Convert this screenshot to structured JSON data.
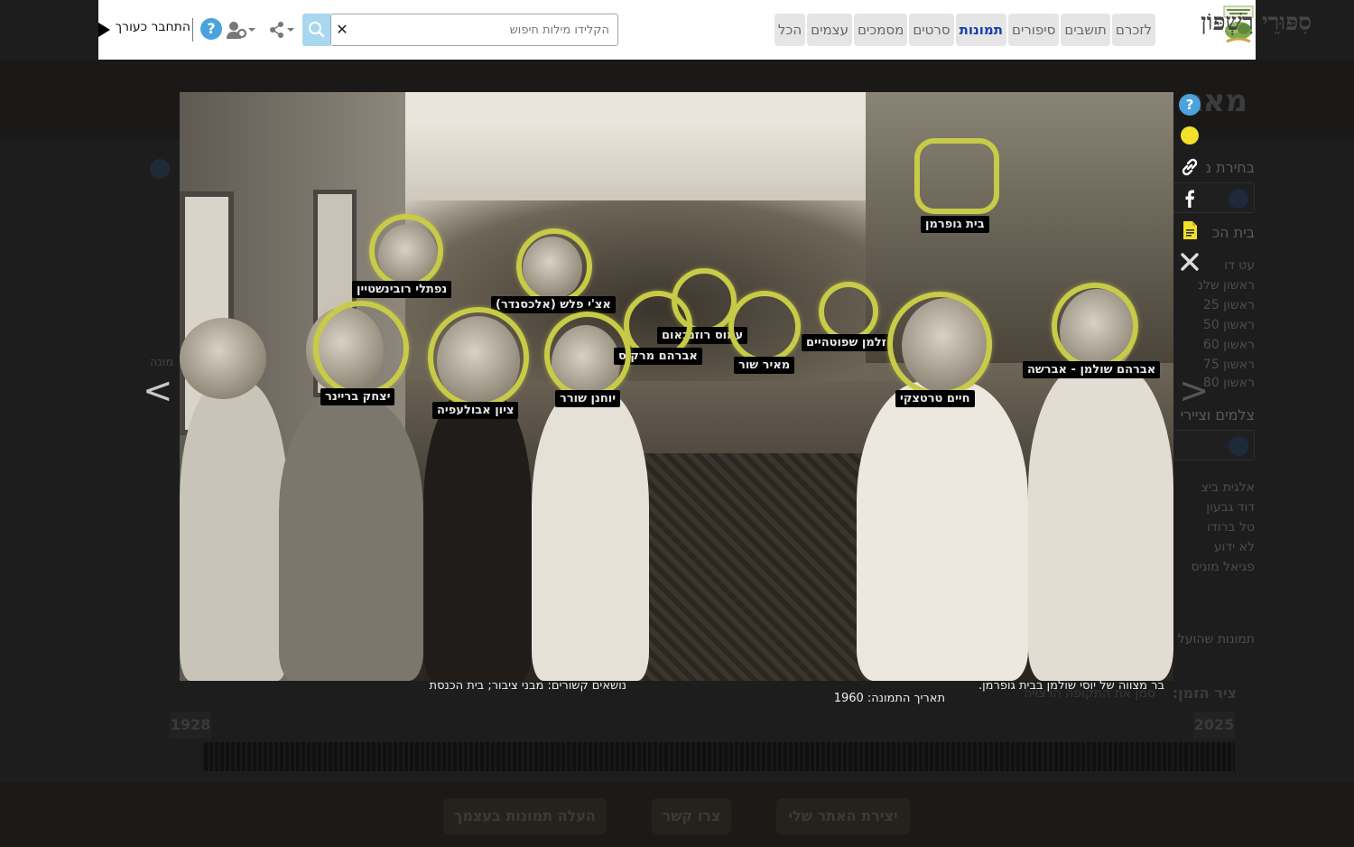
{
  "site": {
    "title": "סִפּוּרֵי רִשְׁפּוֹן"
  },
  "nav": {
    "tabs": [
      {
        "label": "לזכרם",
        "active": false
      },
      {
        "label": "תושבים",
        "active": false
      },
      {
        "label": "סיפורים",
        "active": false
      },
      {
        "label": "תמונות",
        "active": true
      },
      {
        "label": "סרטים",
        "active": false
      },
      {
        "label": "מסמכים",
        "active": false
      },
      {
        "label": "עצמים",
        "active": false
      },
      {
        "label": "הכל",
        "active": false
      }
    ]
  },
  "search": {
    "placeholder": "הקלידו מילות חיפוש",
    "value": ""
  },
  "header_tools": {
    "help": "?",
    "login_label": "התחבר כעורך"
  },
  "lightbox": {
    "tags": [
      {
        "label": "בית גופרמן"
      },
      {
        "label": "נפתלי רובינשטיין"
      },
      {
        "label": "אצ'י פלש (אלכסנדר)"
      },
      {
        "label": "עמוס רוזנבאום"
      },
      {
        "label": "זלמן שפוטהיים"
      },
      {
        "label": "אברהם שולמן - אברשה"
      },
      {
        "label": "אברהם מרקוס"
      },
      {
        "label": "מאיר שור"
      },
      {
        "label": "יצחק בריינר"
      },
      {
        "label": "ציון אבולעפיה"
      },
      {
        "label": "יוחנן שורר"
      },
      {
        "label": "חיים טרטצקי"
      }
    ],
    "caption": "בר מצווה של יוסי שולמן בבית גופרמן.",
    "date": "תאריך התמונה: 1960",
    "topics": "נושאים קשורים: מבני ציבור; בית הכנסת",
    "prev_symbol": "<",
    "next_symbol": ">"
  },
  "colors": {
    "tag": "#c7cb47",
    "active_tab": "#1a3ea8",
    "help": "#4aa3dc"
  },
  "background_page": {
    "title": "מאג",
    "side_lines": [
      "בחירת נ",
      "בית הכ",
      "עט דו",
      "ראשון שלנ",
      "ראשון 25",
      "ראשון 50",
      "ראשון 60",
      "ראשון 75",
      "ראשון 80",
      "צלמים וציירי",
      "אלגית ביצ",
      "דוד גבעון",
      "טל ברודו",
      "לא ידוע",
      "פגיאל מוניס",
      "תמונות שהועל"
    ],
    "left_text": "מונה",
    "timeline_title": "ציר הזמן:",
    "timeline_sub": "סמן את התקופה הרצויה",
    "year_start": "1928",
    "year_end": "2025",
    "footer_buttons": [
      "יצירת האתר שלי",
      "צרו קשר",
      "העלה תמונות בעצמך"
    ]
  }
}
